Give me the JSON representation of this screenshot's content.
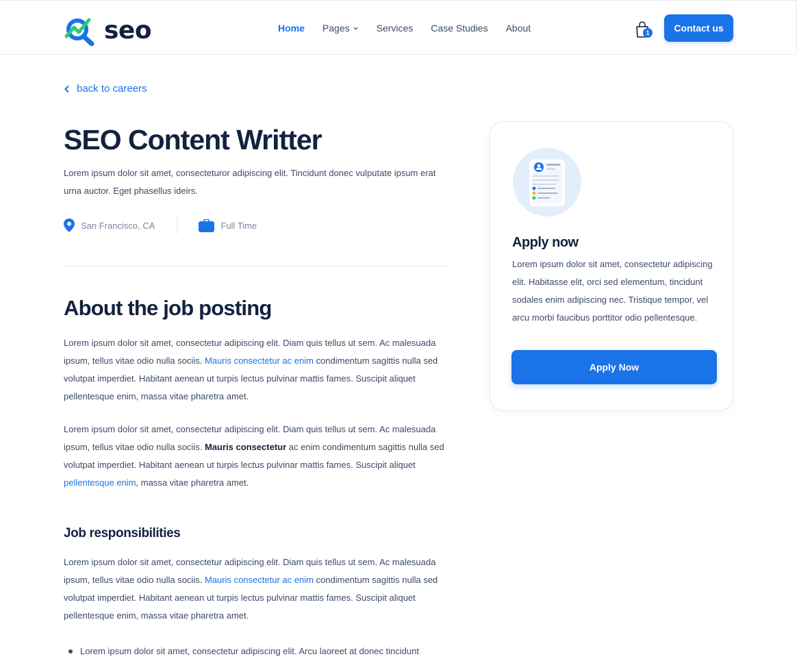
{
  "brand": {
    "name": "seo"
  },
  "nav": {
    "items": [
      {
        "label": "Home",
        "active": true
      },
      {
        "label": "Pages",
        "active": false
      },
      {
        "label": "Services",
        "active": false
      },
      {
        "label": "Case Studies",
        "active": false
      },
      {
        "label": "About",
        "active": false
      }
    ],
    "cart_count": "1",
    "contact_label": "Contact us"
  },
  "back_link": "back to careers",
  "job": {
    "title": "SEO Content Writter",
    "intro": "Lorem ipsum dolor sit amet, consecteturor adipiscing elit. Tincidunt donec vulputate ipsum erat urna auctor. Eget phasellus ideirs.",
    "location": "San Francisco, CA",
    "type": "Full Time"
  },
  "about": {
    "heading": "About the job posting",
    "p1_a": "Lorem ipsum dolor sit amet, consectetur adipiscing elit. Diam quis tellus ut sem. Ac malesuada ipsum, tellus vitae odio nulla sociis.",
    "p1_link": "Mauris consectetur ac enim",
    "p1_b": "condimentum sagittis nulla sed volutpat imperdiet. Habitant aenean ut turpis lectus pulvinar mattis fames. Suscipit aliquet pellentesque enim, massa vitae pharetra amet.",
    "p2_a": "Lorem ipsum dolor sit amet, consectetur adipiscing elit. Diam quis tellus ut sem. Ac malesuada ipsum, tellus vitae odio nulla sociis.",
    "p2_bold": "Mauris consectetur",
    "p2_b": "ac enim condimentum sagittis nulla sed volutpat imperdiet. Habitant aenean ut turpis lectus pulvinar mattis fames. Suscipit aliquet",
    "p2_link": "pellentesque enim",
    "p2_c": ", massa vitae pharetra amet."
  },
  "responsibilities": {
    "heading": "Job responsibilities",
    "p_a": "Lorem ipsum dolor sit amet, consectetur adipiscing elit. Diam quis tellus ut sem. Ac malesuada ipsum, tellus vitae odio nulla sociis.",
    "p_link": "Mauris consectetur ac enim",
    "p_b": "condimentum sagittis nulla sed volutpat imperdiet. Habitant aenean ut turpis lectus pulvinar mattis fames. Suscipit aliquet pellentesque enim, massa vitae pharetra amet.",
    "bullets": [
      "Lorem ipsum dolor sit amet, consectetur adipiscing elit. Arcu laoreet at donec tincidunt"
    ]
  },
  "apply_card": {
    "title": "Apply now",
    "text": "Lorem ipsum dolor sit amet, consectetur adipiscing elit. Habitasse elit, orci sed elementum, tincidunt sodales enim adipiscing nec. Tristique tempor, vel arcu morbi faucibus porttitor odio pellentesque.",
    "button_label": "Apply Now"
  },
  "colors": {
    "accent": "#1a73e8",
    "heading": "#12223f",
    "body": "#3b4a66",
    "muted": "#7b869a",
    "logo_green": "#2ecc71"
  }
}
